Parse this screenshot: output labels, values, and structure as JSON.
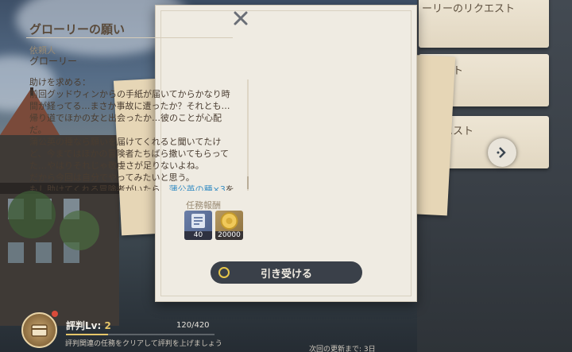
{
  "dialog": {
    "title": "グローリーの願い",
    "client_label": "依頼人",
    "client_name": "グローリー",
    "body_prefix": "助けを求める：\n前回グッドウィンからの手紙が届いてからかなり時間が経ってる…まさか事故に遭ったか？それとも…帰り道でほかの女と出会ったか…彼のことが心配だ。\n蒲公英の種なら願いを届けてくれると聞いてたけど、今まではほかの冒険者たちばら撒いてもらってた…やはりそれじゃ敬虔さが足りないよね。\nだから今回は自分でやってみたいと思う。\nもし助けてくれる冒険者がいたら、",
    "body_highlight": "蒲公英の種×3",
    "body_suffix": "を",
    "reward_label": "任務報酬",
    "rewards": [
      {
        "icon": "adventure-exp-icon",
        "amount": "40"
      },
      {
        "icon": "mora-coin-icon",
        "amount": "20000"
      }
    ],
    "accept_label": "引き受ける"
  },
  "side_requests": [
    {
      "label": "ーリーのリクエスト"
    },
    {
      "label": "ウエスト"
    },
    {
      "label": "リクエスト"
    }
  ],
  "reputation": {
    "label": "評判Lv: ",
    "level": "2",
    "count": "120/420",
    "progress": 0.2857,
    "hint": "評判関連の任務をクリアして評判を上げましょう"
  },
  "refresh_text": "次回の更新まで: 3日",
  "colors": {
    "accent": "#e6c66a",
    "highlight": "#3a8fc4",
    "paper": "#efebe2"
  }
}
